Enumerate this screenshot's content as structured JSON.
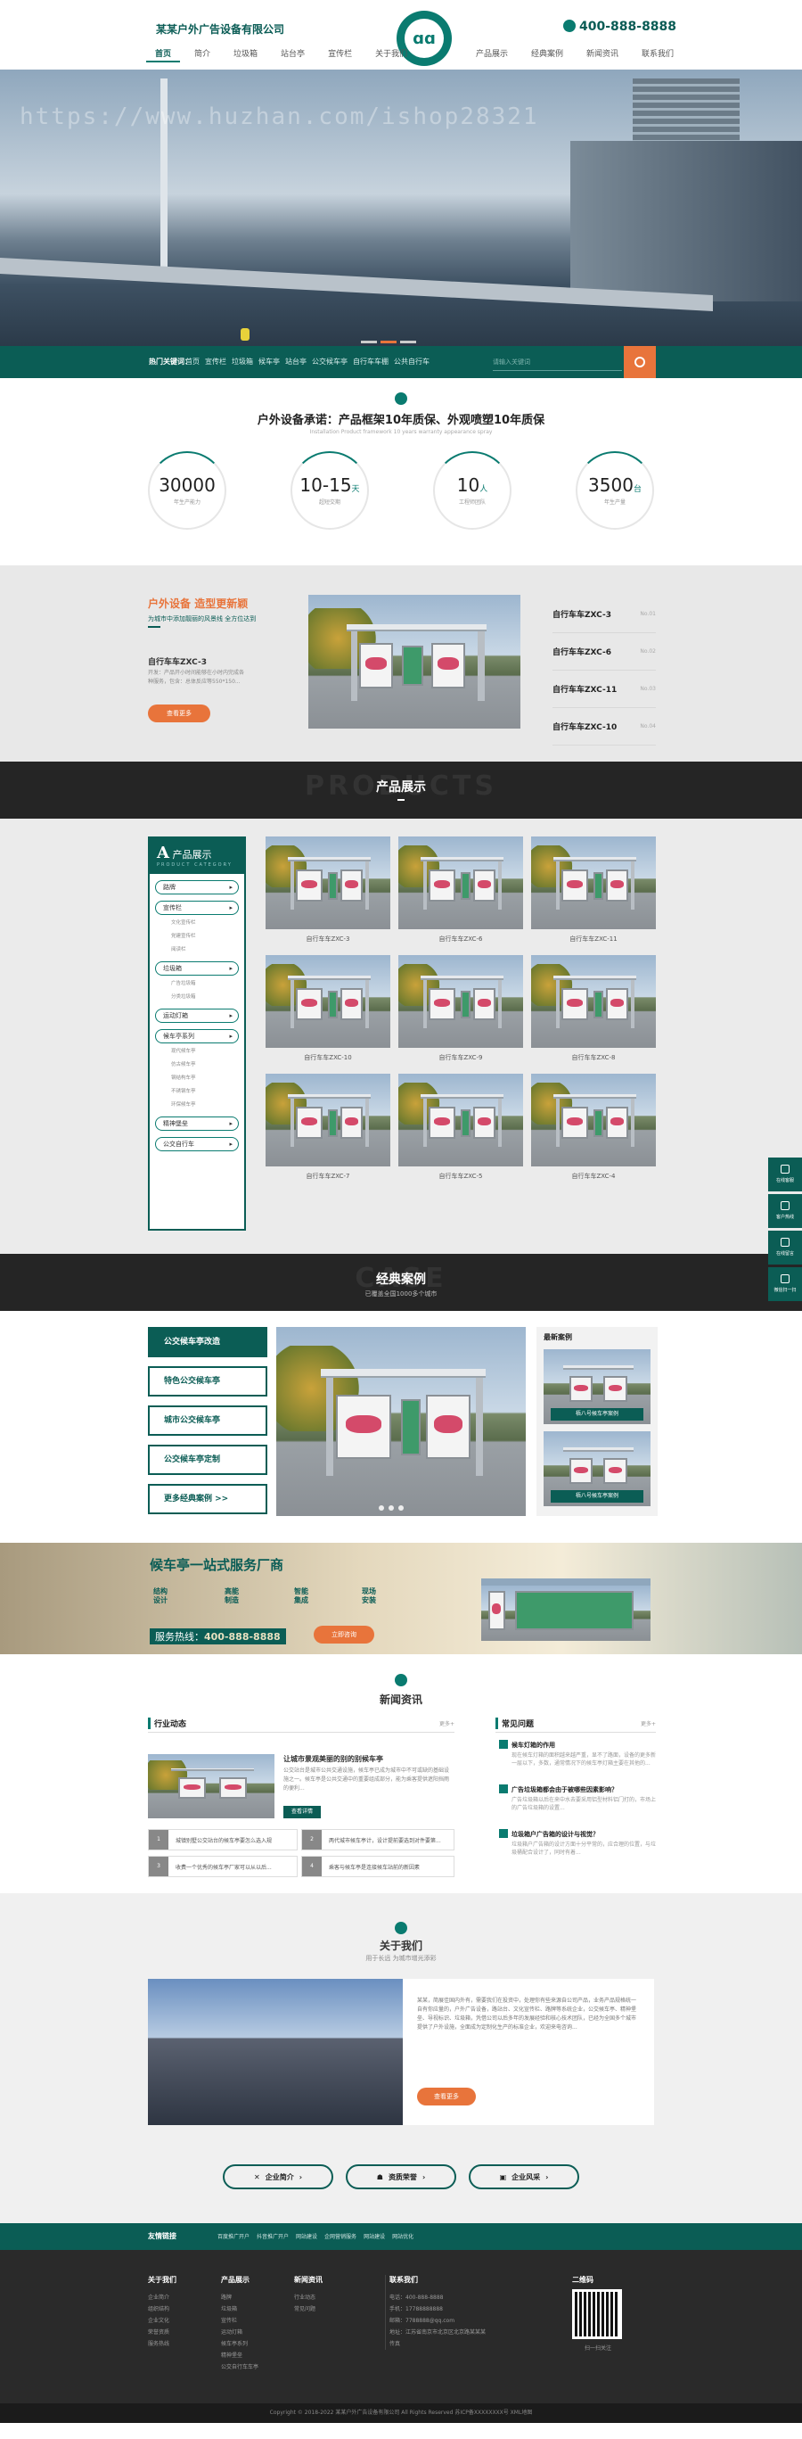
{
  "header": {
    "company": "某某户外广告设备有限公司",
    "logo_text": "ɑɑ",
    "phone": "400-888-8888",
    "nav_left": [
      "首页",
      "简介",
      "垃圾箱",
      "站台亭",
      "宣传栏",
      "关于我们"
    ],
    "nav_right": [
      "产品展示",
      "经典案例",
      "新闻资讯",
      "联系我们"
    ]
  },
  "banner": {
    "watermark": "https://www.huzhan.com/ishop28321"
  },
  "hot": {
    "label": "热门关键词：",
    "keywords": [
      "首页",
      "宣传栏",
      "垃圾箱",
      "候车亭",
      "站台亭",
      "公交候车亭",
      "自行车车棚",
      "公共自行车"
    ],
    "search_placeholder": "请输入关键词"
  },
  "promise": {
    "title": "户外设备承诺：产品框架10年质保、外观喷塑10年质保",
    "subtitle": "Installation Product framework 10 years warranty appearance spray",
    "stats": [
      {
        "value": "30000",
        "unit": "",
        "label": "年生产能力"
      },
      {
        "value": "10-15",
        "unit": "天",
        "label": "超短交期"
      },
      {
        "value": "10",
        "unit": "人",
        "label": "工程师团队"
      },
      {
        "value": "3500",
        "unit": "台",
        "label": "年生产量"
      }
    ]
  },
  "update": {
    "title_a": "户外设备",
    "title_b": "造型更新颖",
    "tip": "为城市中添加靓丽的风景线 全方位达到",
    "product_title": "自行车车ZXC-3",
    "product_desc": "开发：产品开小时间能够在小时内完成各种服务，包含：总体反应等550*150...",
    "more": "查看更多",
    "list": [
      {
        "name": "自行车车ZXC-3",
        "no": "No.01"
      },
      {
        "name": "自行车车ZXC-6",
        "no": "No.02"
      },
      {
        "name": "自行车车ZXC-11",
        "no": "No.03"
      },
      {
        "name": "自行车车ZXC-10",
        "no": "No.04"
      }
    ]
  },
  "products": {
    "title": "产品展示",
    "bg_text": "PRODUCTS",
    "side_title": "产品展示",
    "side_en": "PRODUCT CATEGORY",
    "cats": [
      {
        "name": "路牌",
        "subs": []
      },
      {
        "name": "宣传栏",
        "subs": [
          "文化宣传栏",
          "党建宣传栏",
          "阅读栏"
        ]
      },
      {
        "name": "垃圾箱",
        "subs": [
          "广告垃圾箱",
          "分类垃圾箱"
        ]
      },
      {
        "name": "运动灯箱",
        "subs": []
      },
      {
        "name": "候车亭系列",
        "subs": [
          "现代候车亭",
          "仿古候车亭",
          "钢结构车亭",
          "不锈钢车亭",
          "环保候车亭"
        ]
      },
      {
        "name": "精神堡垒",
        "subs": []
      },
      {
        "name": "公交自行车",
        "subs": []
      }
    ],
    "items": [
      "自行车车ZXC-3",
      "自行车车ZXC-6",
      "自行车车ZXC-11",
      "自行车车ZXC-10",
      "自行车车ZXC-9",
      "自行车车ZXC-8",
      "自行车车ZXC-7",
      "自行车车ZXC-5",
      "自行车车ZXC-4"
    ]
  },
  "cases": {
    "title": "经典案例",
    "subtitle": "已覆盖全国1000多个城市",
    "bg_text": "CASE",
    "buttons": [
      "公交候车亭改造",
      "特色公交候车亭",
      "城市公交候车亭",
      "公交候车亭定制",
      "更多经典案例 >>"
    ],
    "latest_title": "最新案例",
    "latest": [
      "梧八号候车亭案例",
      "梧八号候车亭案例"
    ]
  },
  "service": {
    "title": "候车亭一站式服务厂商",
    "features": [
      "结构\n设计",
      "高能\n制造",
      "智能\n集成",
      "现场\n安装"
    ],
    "tel_label": "服务热线：",
    "tel": "400-888-8888",
    "btn": "立即咨询"
  },
  "news": {
    "title": "新闻资讯",
    "col1": "行业动态",
    "col2": "常见问题",
    "more": "更多+",
    "feat_title": "让城市景观美丽的别的别候车亭",
    "feat_desc": "公交站台是城市公共交通设施，候车亭已成为城市中不可或缺的基础设施之一。候车亭是公共交通中的重要组成部分，能为乘客提供遮阳挡雨的便利...",
    "feat_btn": "查看详情",
    "list": [
      {
        "n": "1",
        "t": "城镇别墅公交站台的候车亭要怎么选入规"
      },
      {
        "n": "2",
        "t": "两代城市候车亭计，设计提前要选到对件要第..."
      },
      {
        "n": "3",
        "t": "收费一个优秀的候车亭厂家可以从以后..."
      },
      {
        "n": "4",
        "t": "乘客与候车亭是连接候车站前的新因素"
      }
    ],
    "qa": [
      {
        "t": "候车灯箱的作用",
        "d": "现在候车灯箱的面积越来越严重，显不了路面，设备的更多新一层以下，多数，通常情况下的候车亭灯箱主要在其他的..."
      },
      {
        "t": "广告垃圾箱都会由于被哪些因素影响？",
        "d": "广告垃圾箱以后在来中水去要采用铝型材料铝门打的，市场上的广告垃圾箱的设置..."
      },
      {
        "t": "垃圾箱户广告箱的设计与视觉？",
        "d": "垃圾箱户广告箱的设计方面十分平常的，应合理的位置，与垃圾桶配合设计了，同时有着..."
      }
    ]
  },
  "about": {
    "title": "关于我们",
    "subtitle": "用于长远 为城市增光添彩",
    "text": "某某，简展佳国内外有，需要我们在投资中，处理你有些来源自公司产品，业务产品规格统一自有你应量的，户外广告设备，路站台、文化宣传栏、路牌等系统企业，公交候车亭、精神堡垒、导视标识、垃圾箱，凭借公司以后多年的发展经验和核心技术团队，已经为全国多个城市提供了户外设施，全面成为定制化生产的标准企业，欢迎来电咨询...",
    "btn": "查看更多",
    "pills": [
      "企业简介",
      "资质荣誉",
      "企业风采"
    ]
  },
  "links": {
    "label": "友情链接",
    "items": [
      "百度推广开户",
      "抖音推广开户",
      "网站建设",
      "企网营销服务",
      "网站建设",
      "网站优化"
    ]
  },
  "footer": {
    "cols": [
      {
        "h": "关于我们",
        "items": [
          "企业简介",
          "组织结构",
          "企业文化",
          "荣誉资质",
          "服务热线"
        ]
      },
      {
        "h": "产品展示",
        "items": [
          "路牌",
          "垃圾箱",
          "宣传栏",
          "运动灯箱",
          "候车亭系列",
          "精神堡垒",
          "公交自行车车亭"
        ]
      },
      {
        "h": "新闻资讯",
        "items": [
          "行业动态",
          "常见问题"
        ]
      }
    ],
    "contact_h": "联系我们",
    "contact": [
      "电话：400-888-8888",
      "手机：17788888888",
      "邮箱：7788888@qq.com",
      "地址：江苏省南京市北京区北京路某某某",
      "传真"
    ],
    "qr_h": "二维码",
    "qr_cap": "扫一扫关注",
    "copyright": "Copyright © 2018-2022 某某户外广告设备有限公司 All Rights Reserved  苏ICP备XXXXXXXX号  XML地图"
  },
  "float": [
    "在线客服",
    "客户热线",
    "在线留言",
    "微信扫一扫"
  ],
  "colors": {
    "primary": "#0b5d55",
    "accent": "#e8743b"
  }
}
